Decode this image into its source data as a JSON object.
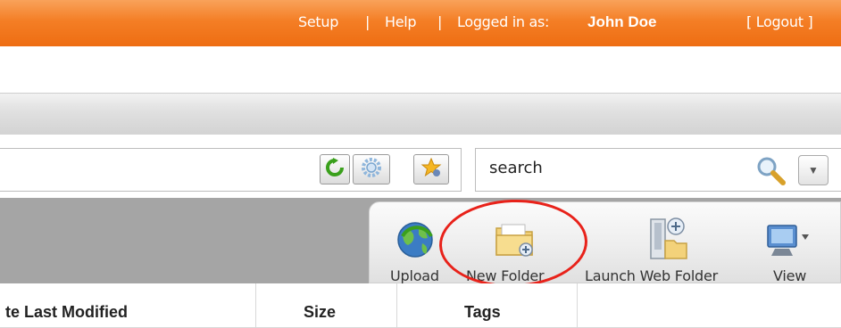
{
  "header": {
    "setup": "Setup",
    "sep1": "|",
    "help": "Help",
    "sep2": "|",
    "logged_in_label": "Logged in as:",
    "user_name": "John Doe",
    "logout": "[ Logout ]"
  },
  "search": {
    "value": "search"
  },
  "toolbar": {
    "upload": "Upload",
    "new_folder": "New Folder",
    "launch_web_folder": "Launch Web Folder",
    "view": "View"
  },
  "table": {
    "columns": [
      "te Last Modified",
      "Size",
      "Tags"
    ]
  },
  "colors": {
    "header_orange": "#f47e25",
    "annotation_red": "#e8221a"
  },
  "icons": [
    "refresh-icon",
    "settings-icon",
    "favorites-icon",
    "search-icon",
    "dropdown-arrow-icon",
    "upload-icon",
    "new-folder-icon",
    "launch-web-folder-icon",
    "view-icon"
  ]
}
